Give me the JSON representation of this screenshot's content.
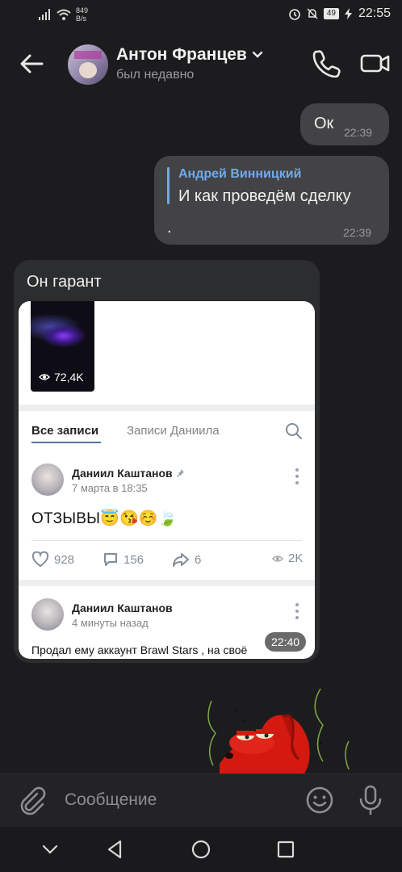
{
  "status_bar": {
    "net_speed_value": "849",
    "net_speed_unit": "B/s",
    "battery": "49",
    "time": "22:55"
  },
  "header": {
    "name": "Антон Францев",
    "status": "был недавно"
  },
  "messages": [
    {
      "direction": "out",
      "text": "Ок",
      "time": "22:39"
    },
    {
      "direction": "out",
      "reply_author": "Андрей Винницкий",
      "reply_text": "И как проведём сделку",
      "text": ".",
      "time": "22:39"
    },
    {
      "direction": "in",
      "text": "Он гарант",
      "time": "22:40"
    }
  ],
  "attachment": {
    "clip_views": "72,4K",
    "tab_all": "Все записи",
    "tab_other": "Записи Даниила",
    "post1": {
      "author": "Даниил Каштанов",
      "date": "7 марта в 18:35",
      "text": "ОТЗЫВЫ😇😘☺️🍃",
      "likes": "928",
      "comments": "156",
      "shares": "6",
      "views": "2K"
    },
    "post2": {
      "author": "Даниил Каштанов",
      "date": "4 минуты назад",
      "text": "Продал ему аккаунт Brawl Stars , на своё"
    }
  },
  "composer": {
    "placeholder": "Сообщение"
  },
  "icons": [
    "back-arrow-icon",
    "chevron-down-icon",
    "phone-icon",
    "video-camera-icon",
    "eye-icon",
    "search-icon",
    "pin-icon",
    "heart-icon",
    "comment-icon",
    "share-icon",
    "paperclip-icon",
    "smile-icon",
    "microphone-icon"
  ],
  "colors": {
    "background": "#1c1c1e",
    "bubble_out": "#434345",
    "bubble_in": "#2c2d2e",
    "reply_accent": "#71aaeb"
  }
}
